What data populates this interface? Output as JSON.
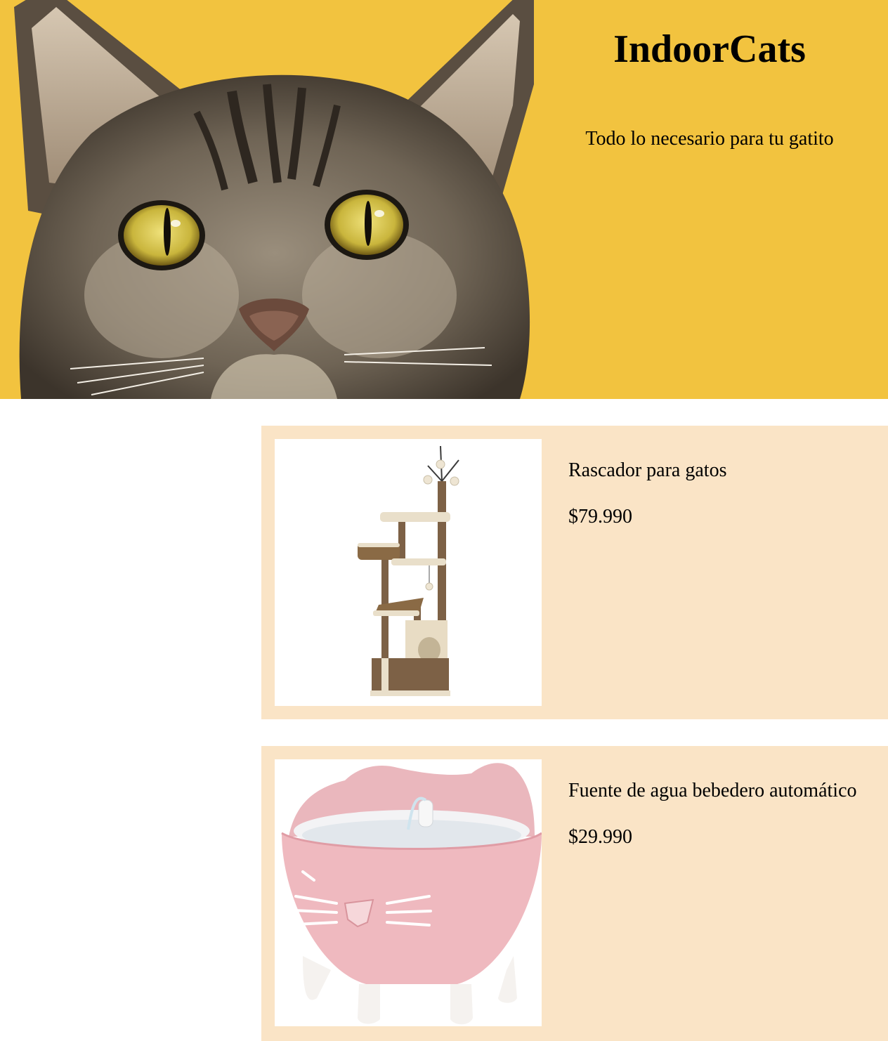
{
  "site": {
    "title": "IndoorCats",
    "tagline": "Todo lo necesario para tu gatito"
  },
  "hero": {
    "image": "tabby-cat-face-photo",
    "background_color": "#f2c33f"
  },
  "products": [
    {
      "name": "Rascador para gatos",
      "price": "$79.990",
      "image": "cat-tree-scratcher"
    },
    {
      "name": "Fuente de agua bebedero automático",
      "price": "$29.990",
      "image": "pink-cat-water-fountain"
    }
  ],
  "colors": {
    "card_background": "#fae4c6",
    "page_background": "#ffffff"
  }
}
